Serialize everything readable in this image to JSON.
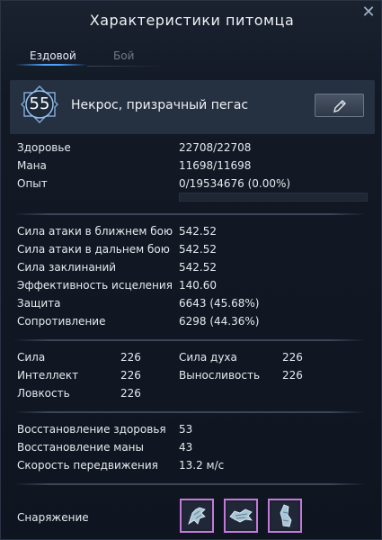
{
  "window": {
    "title": "Характеристики питомца"
  },
  "tabs": [
    {
      "label": "Ездовой",
      "active": true
    },
    {
      "label": "Бой",
      "active": false
    }
  ],
  "pet": {
    "level": "55",
    "name": "Некрос, призрачный пегас"
  },
  "vitals": {
    "health_label": "Здоровье",
    "health_value": "22708/22708",
    "mana_label": "Мана",
    "mana_value": "11698/11698",
    "exp_label": "Опыт",
    "exp_value": "0/19534676 (0.00%)",
    "exp_fraction": 0.0
  },
  "combat": [
    {
      "label": "Сила атаки в ближнем бою",
      "value": "542.52"
    },
    {
      "label": "Сила атаки в дальнем бою",
      "value": "542.52"
    },
    {
      "label": "Сила заклинаний",
      "value": "542.52"
    },
    {
      "label": "Эффективность исцеления",
      "value": "140.60"
    },
    {
      "label": "Защита",
      "value": "6643 (45.68%)"
    },
    {
      "label": "Сопротивление",
      "value": "6298 (44.36%)"
    }
  ],
  "attributes": {
    "strength_label": "Сила",
    "strength_value": "226",
    "intellect_label": "Интеллект",
    "intellect_value": "226",
    "agility_label": "Ловкость",
    "agility_value": "226",
    "spirit_label": "Сила духа",
    "spirit_value": "226",
    "stamina_label": "Выносливость",
    "stamina_value": "226"
  },
  "regen": [
    {
      "label": "Восстановление здоровья",
      "value": "53"
    },
    {
      "label": "Восстановление маны",
      "value": "43"
    },
    {
      "label": "Скорость передвижения",
      "value": "13.2 м/с"
    }
  ],
  "equipment": {
    "label": "Снаряжение",
    "slots": [
      {
        "icon": "armor-head-icon"
      },
      {
        "icon": "armor-body-icon"
      },
      {
        "icon": "armor-leg-icon"
      }
    ],
    "slot_border_color": "#c27ad8"
  },
  "colors": {
    "accent": "#4aa3ff",
    "header_bg": "#253040"
  }
}
